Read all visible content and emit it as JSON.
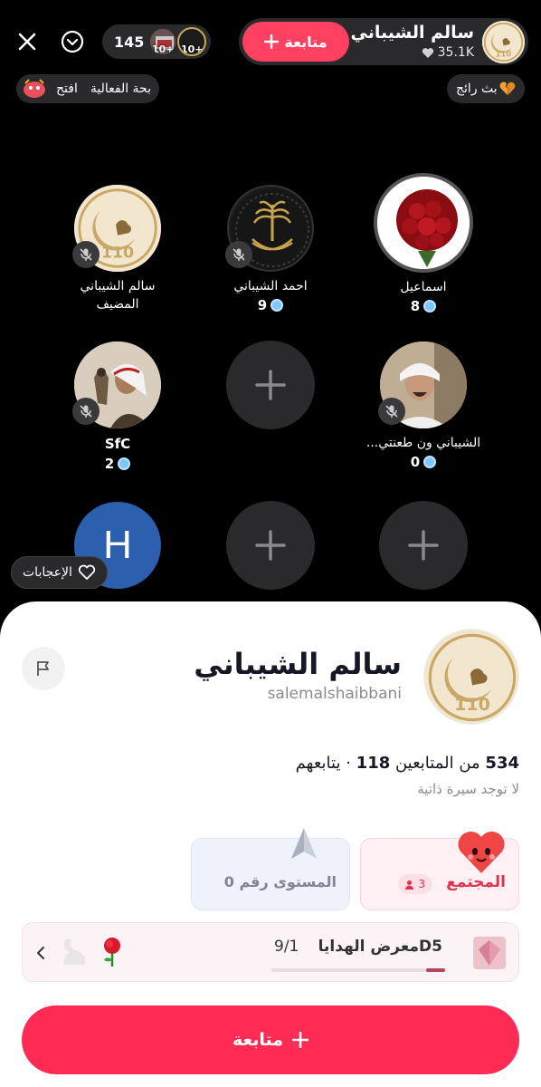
{
  "top_bar": {
    "viewer_count": "145",
    "viewer_badges": [
      "10+",
      "10+"
    ],
    "host_name": "سالم الشيباني",
    "host_likes": "35.1K",
    "follow_label": "متابعة",
    "chip_event": "افتح",
    "chip_event_title": "بحة الفعالية",
    "chip_trending": "بث رائج"
  },
  "seats": [
    {
      "name": "اسماعيل",
      "gems": "8"
    },
    {
      "name": "احمد الشيباني",
      "gems": "9"
    },
    {
      "name": "سالم الشيباني",
      "sub": "المضيف"
    },
    {
      "name": "الشيباني ون طعنتي...",
      "gems": "0"
    },
    {
      "name": "SfC",
      "gems": "2"
    },
    {
      "initial": "H"
    }
  ],
  "likes_label": "الإعجابات",
  "profile": {
    "name": "سالم الشيباني",
    "handle": "salemalshaibbani",
    "followers_count": "534",
    "followers_label": "من المتابعين",
    "following_count": "118",
    "following_label": "يتابعهم",
    "separator": "·",
    "bio": "لا توجد سيرة ذاتية",
    "community_label": "المجتمع",
    "community_count": "3",
    "level_label": "المستوى رقم 0",
    "gift_level": "D5",
    "gift_title": "معرض الهدايا",
    "gift_progress_text": "9/1",
    "gift_progress": 0.11,
    "follow_label": "متابعة"
  },
  "colors": {
    "accent": "#fe2c55",
    "gem": "#7cc7ff"
  }
}
